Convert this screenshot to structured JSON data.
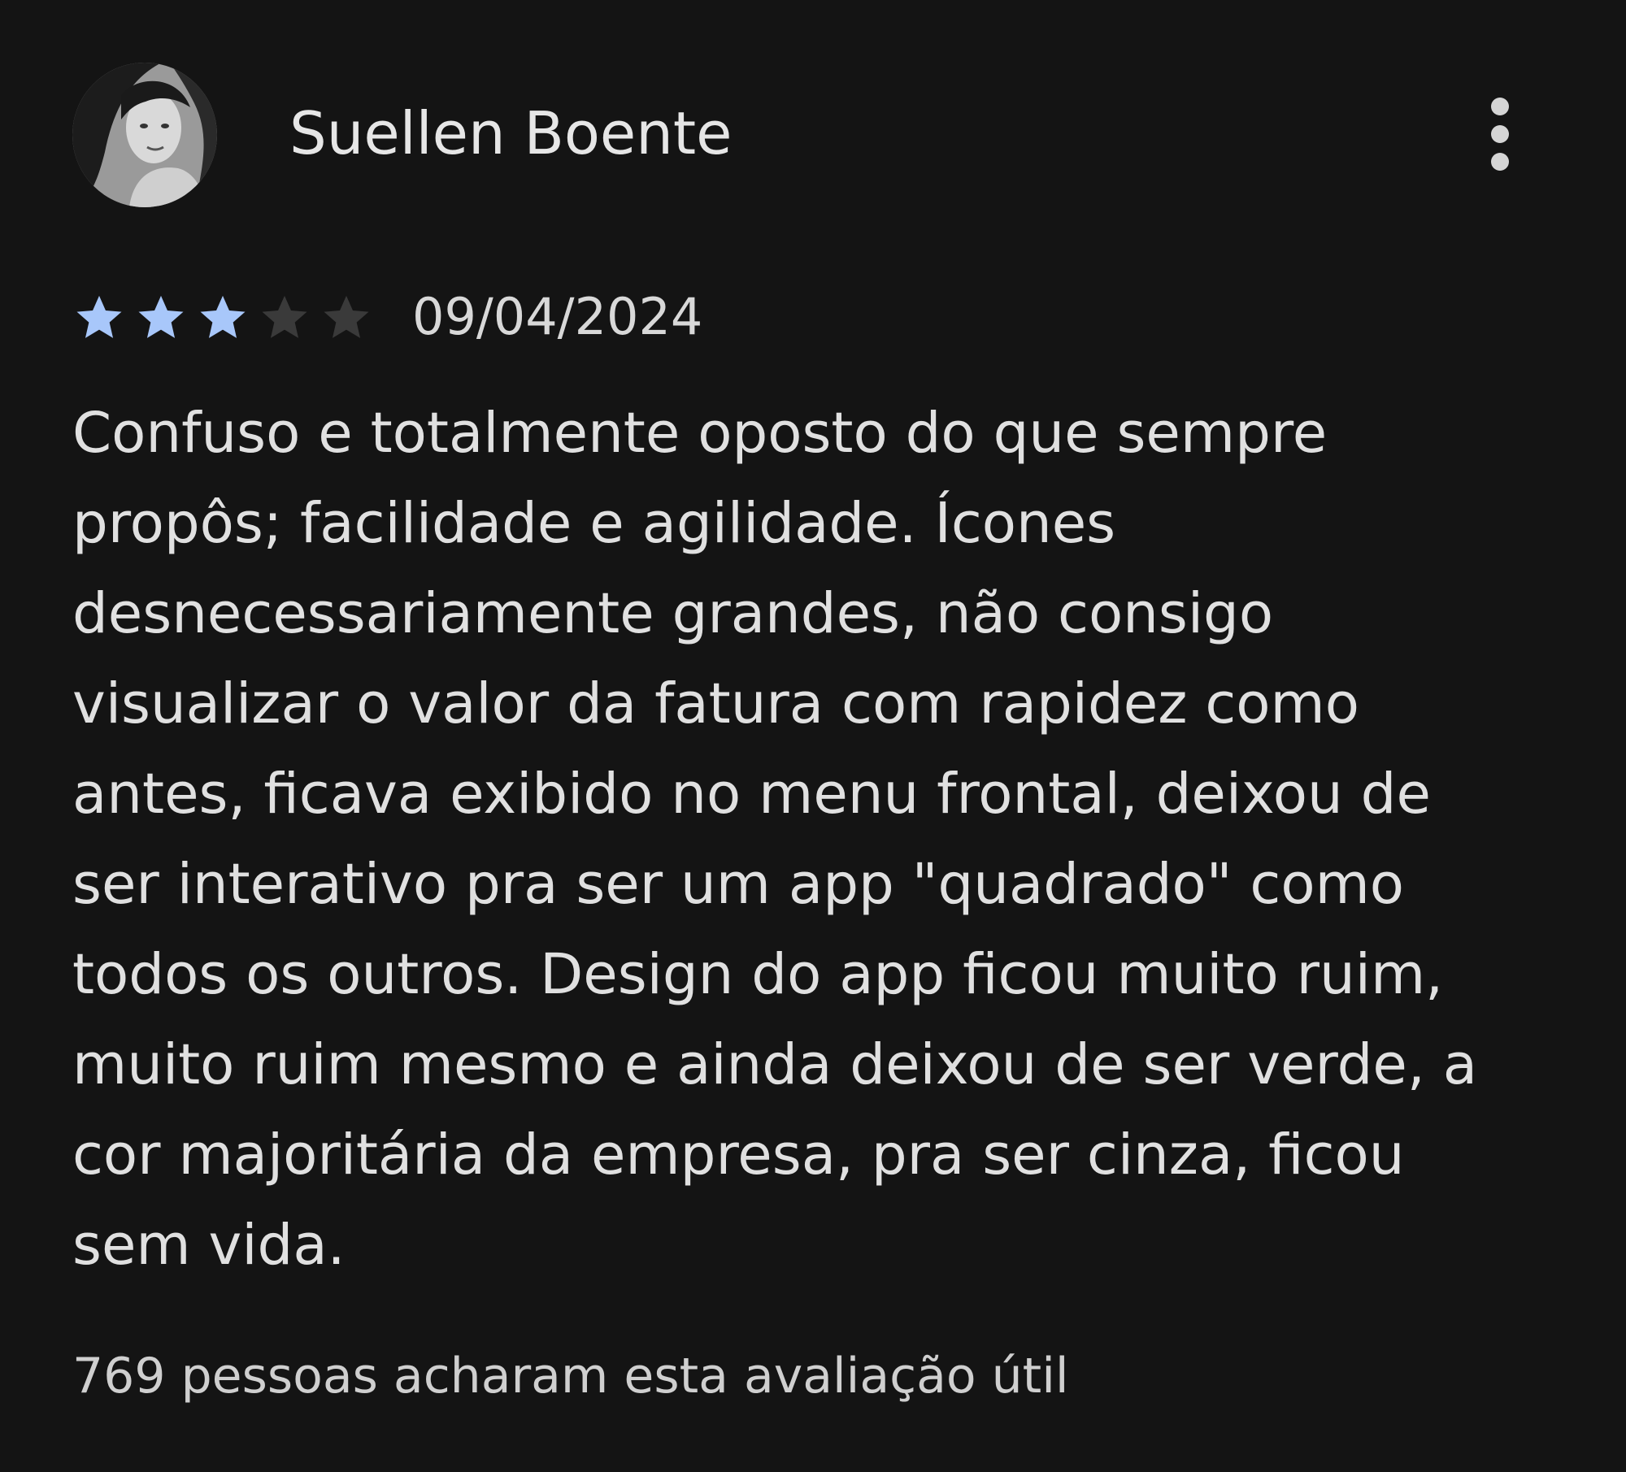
{
  "review": {
    "author_name": "Suellen Boente",
    "rating": 3,
    "rating_max": 5,
    "date": "09/04/2024",
    "text_lines": [
      "Confuso e totalmente oposto do que sempre",
      "propôs; facilidade e agilidade. Ícones",
      "desnecessariamente grandes, não consigo",
      "visualizar o valor da fatura com rapidez como",
      "antes, ficava exibido no menu frontal, deixou de",
      "ser interativo pra ser um app \"quadrado\" como",
      "todos os outros. Design do app ficou muito ruim,",
      "muito ruim mesmo e ainda deixou de ser verde, a",
      "cor majoritária da empresa, pra ser cinza, ficou",
      "sem vida."
    ],
    "helpful_text": "769 pessoas acharam esta avaliação útil"
  },
  "icons": {
    "menu": "more-vert-icon",
    "star": "star-icon",
    "avatar": "user-avatar"
  },
  "colors": {
    "background": "#141414",
    "star_filled": "#a8c7fa",
    "star_empty": "#3a3a3a",
    "text": "#e3e3e3"
  }
}
